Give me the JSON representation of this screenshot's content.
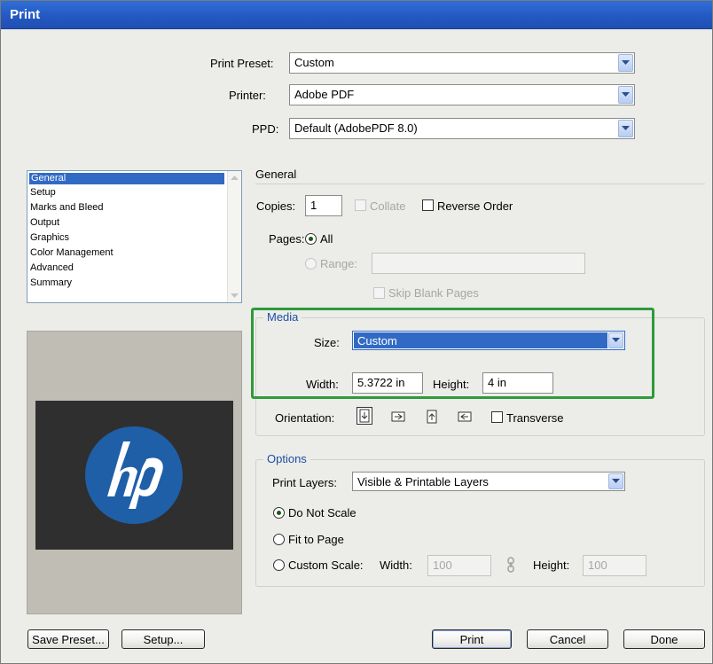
{
  "window": {
    "title": "Print"
  },
  "preset": {
    "label": "Print Preset:",
    "value": "Custom"
  },
  "printer": {
    "label": "Printer:",
    "value": "Adobe PDF"
  },
  "ppd": {
    "label": "PPD:",
    "value": "Default (AdobePDF 8.0)"
  },
  "categories": {
    "items": [
      "General",
      "Setup",
      "Marks and Bleed",
      "Output",
      "Graphics",
      "Color Management",
      "Advanced",
      "Summary"
    ],
    "selected": "General"
  },
  "general": {
    "heading": "General",
    "copies_label": "Copies:",
    "copies_value": "1",
    "collate_label": "Collate",
    "reverse_label": "Reverse Order",
    "pages_label": "Pages:",
    "all_label": "All",
    "range_label": "Range:",
    "range_value": "",
    "skip_label": "Skip Blank Pages"
  },
  "media": {
    "legend": "Media",
    "size_label": "Size:",
    "size_value": "Custom",
    "width_label": "Width:",
    "width_value": "5.3722 in",
    "height_label": "Height:",
    "height_value": "4 in",
    "orientation_label": "Orientation:",
    "transverse_label": "Transverse"
  },
  "options": {
    "legend": "Options",
    "layers_label": "Print Layers:",
    "layers_value": "Visible & Printable Layers",
    "no_scale_label": "Do Not Scale",
    "fit_label": "Fit to Page",
    "custom_label": "Custom Scale:",
    "cs_width_label": "Width:",
    "cs_width_value": "100",
    "cs_height_label": "Height:",
    "cs_height_value": "100"
  },
  "preview": {
    "logo_text": "hp"
  },
  "buttons": {
    "save_preset": "Save Preset...",
    "setup": "Setup...",
    "print": "Print",
    "cancel": "Cancel",
    "done": "Done"
  },
  "colors": {
    "title_bar": "#2457c0",
    "selection": "#316ac5",
    "highlight_box": "#2f9a3c",
    "hp_blue": "#1e5fa8"
  }
}
